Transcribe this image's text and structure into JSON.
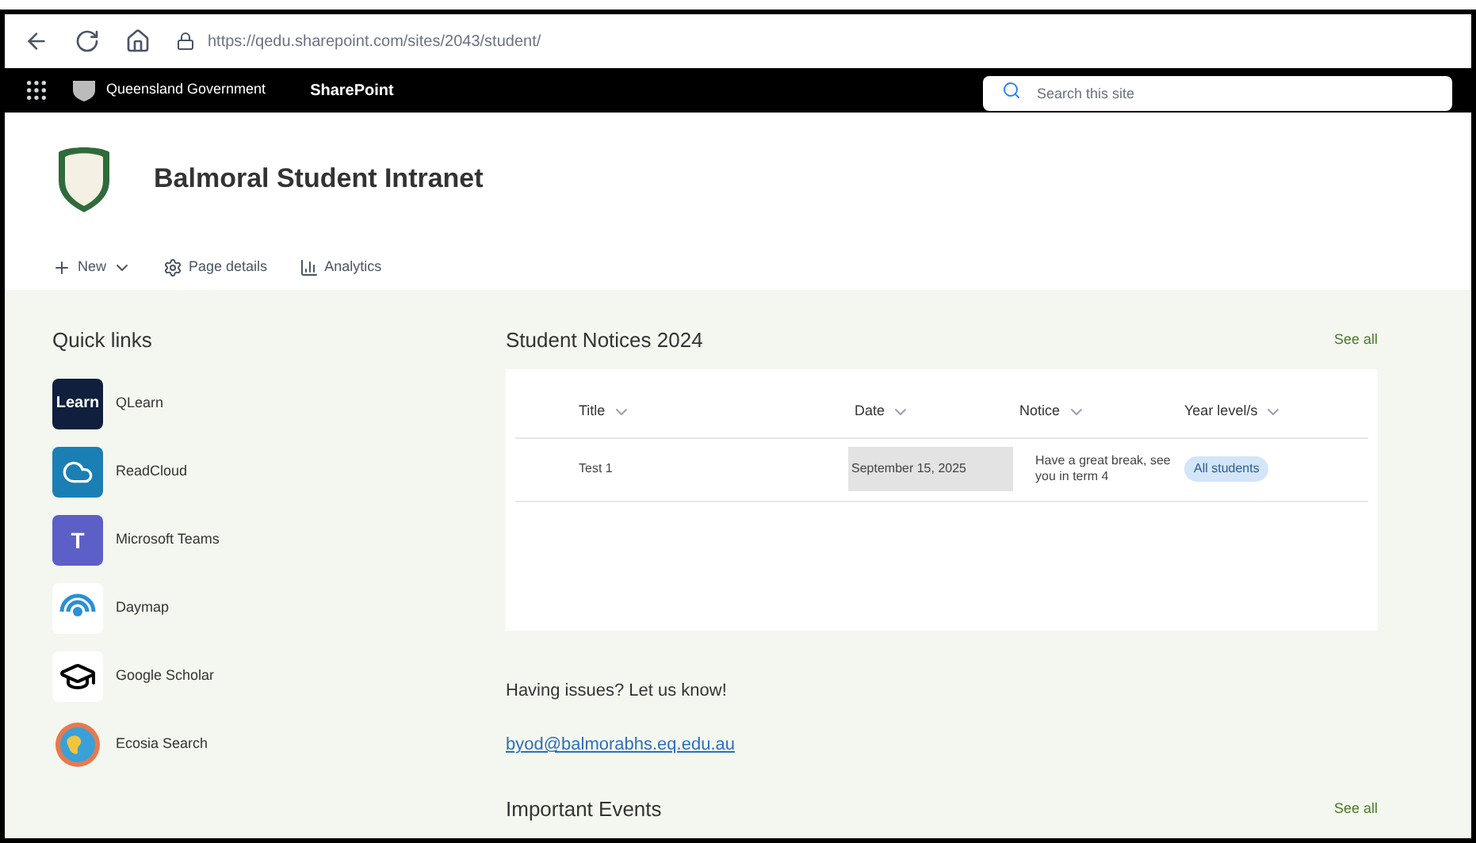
{
  "browser": {
    "url": "https://qedu.sharepoint.com/sites/2043/student/"
  },
  "suite_bar": {
    "brand": "Queensland Government",
    "app": "SharePoint",
    "search": {
      "placeholder": "Search this site"
    }
  },
  "site": {
    "title": "Balmoral Student Intranet"
  },
  "command_bar": [
    {
      "kind": "new",
      "label": "New"
    },
    {
      "kind": "details",
      "label": "Page details"
    },
    {
      "kind": "analytics",
      "label": "Analytics"
    }
  ],
  "quick_links": {
    "title": "Quick links",
    "items": [
      {
        "kind": "learn",
        "label": "QLearn",
        "icon_text": "Learn"
      },
      {
        "kind": "cloud",
        "label": "ReadCloud"
      },
      {
        "kind": "teams",
        "label": "Microsoft Teams",
        "icon_text": "T"
      },
      {
        "kind": "daymap",
        "label": "Daymap"
      },
      {
        "kind": "scholar",
        "label": "Google Scholar"
      },
      {
        "kind": "globe",
        "label": "Ecosia Search"
      }
    ]
  },
  "notices": {
    "title": "Student Notices 2024",
    "see_all": "See all",
    "columns": [
      "Title",
      "Date",
      "Notice",
      "Year level/s"
    ],
    "rows": [
      {
        "title": "Test 1",
        "date": "September 15, 2025",
        "notice": "Have a great break, see you in term 4",
        "year_levels": "All students"
      }
    ]
  },
  "support": {
    "text": "Having issues? Let us know!",
    "email": "byod@balmorabhs.eq.edu.au"
  },
  "events": {
    "title": "Important Events",
    "see_all": "See all"
  }
}
